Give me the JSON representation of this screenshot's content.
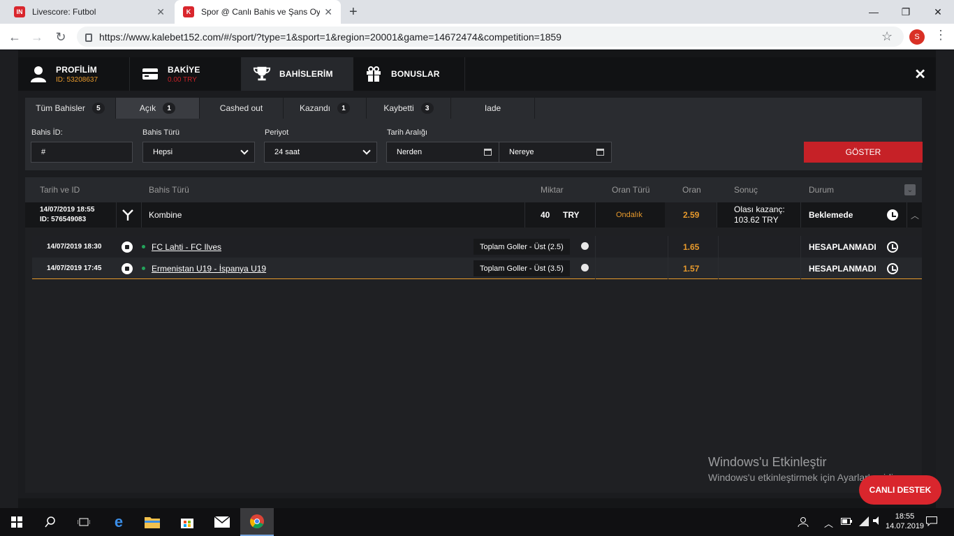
{
  "browser": {
    "tabs": [
      {
        "title": "Livescore: Futbol",
        "favicon": "IN"
      },
      {
        "title": "Spor @ Canlı Bahis ve Şans Oyun",
        "favicon": "K"
      }
    ],
    "url": "https://www.kalebet152.com/#/sport/?type=1&sport=1&region=20001&game=14672474&competition=1859",
    "profile_initial": "S"
  },
  "topnav": {
    "profile": {
      "label": "PROFİLİM",
      "sub": "ID: 53208637"
    },
    "balance": {
      "label": "BAKİYE",
      "sub": "0.00 TRY"
    },
    "bets": {
      "label": "BAHİSLERİM"
    },
    "bonuses": {
      "label": "BONUSLAR"
    }
  },
  "subtabs": [
    {
      "label": "Tüm Bahisler",
      "count": "5"
    },
    {
      "label": "Açık",
      "count": "1"
    },
    {
      "label": "Cashed out",
      "count": ""
    },
    {
      "label": "Kazandı",
      "count": "1"
    },
    {
      "label": "Kaybetti",
      "count": "3"
    },
    {
      "label": "Iade",
      "count": ""
    }
  ],
  "filters": {
    "bet_id_label": "Bahis İD:",
    "bet_id_value": "#",
    "bet_type_label": "Bahis Türü",
    "bet_type_value": "Hepsi",
    "period_label": "Periyot",
    "period_value": "24 saat",
    "date_range_label": "Tarih Aralığı",
    "from_value": "Nerden",
    "to_value": "Nereye",
    "show_button": "GÖSTER"
  },
  "table": {
    "headers": {
      "date_id": "Tarih ve ID",
      "bet_type": "Bahis Türü",
      "amount": "Miktar",
      "odds_type": "Oran Türü",
      "odds": "Oran",
      "result": "Sonuç",
      "status": "Durum"
    },
    "bet": {
      "date": "14/07/2019 18:55",
      "id": "ID: 576549083",
      "type": "Kombine",
      "amount": "40",
      "currency": "TRY",
      "odds_type": "Ondalık",
      "odds": "2.59",
      "possible_win_label": "Olası kazanç:",
      "possible_win": "103.62 TRY",
      "status": "Beklemede"
    },
    "selections": [
      {
        "date": "14/07/2019 18:30",
        "match": "FC Lahti - FC Ilves",
        "market": "Toplam Goller - Üst (2.5)",
        "odds": "1.65",
        "status": "HESAPLANMADI"
      },
      {
        "date": "14/07/2019 17:45",
        "match": "Ermenistan U19 - İspanya U19",
        "market": "Toplam Goller - Üst (3.5)",
        "odds": "1.57",
        "status": "HESAPLANMADI"
      }
    ]
  },
  "watermark": {
    "line1": "Windows'u Etkinleştir",
    "line2": "Windows'u etkinleştirmek için Ayarlar'a gidin."
  },
  "live_support": "CANLI DESTEK",
  "taskbar": {
    "time": "18:55",
    "date": "14.07.2019"
  },
  "colors": {
    "accent": "#e89a2c",
    "primary_button": "#c62127",
    "live_support": "#d9262d"
  }
}
